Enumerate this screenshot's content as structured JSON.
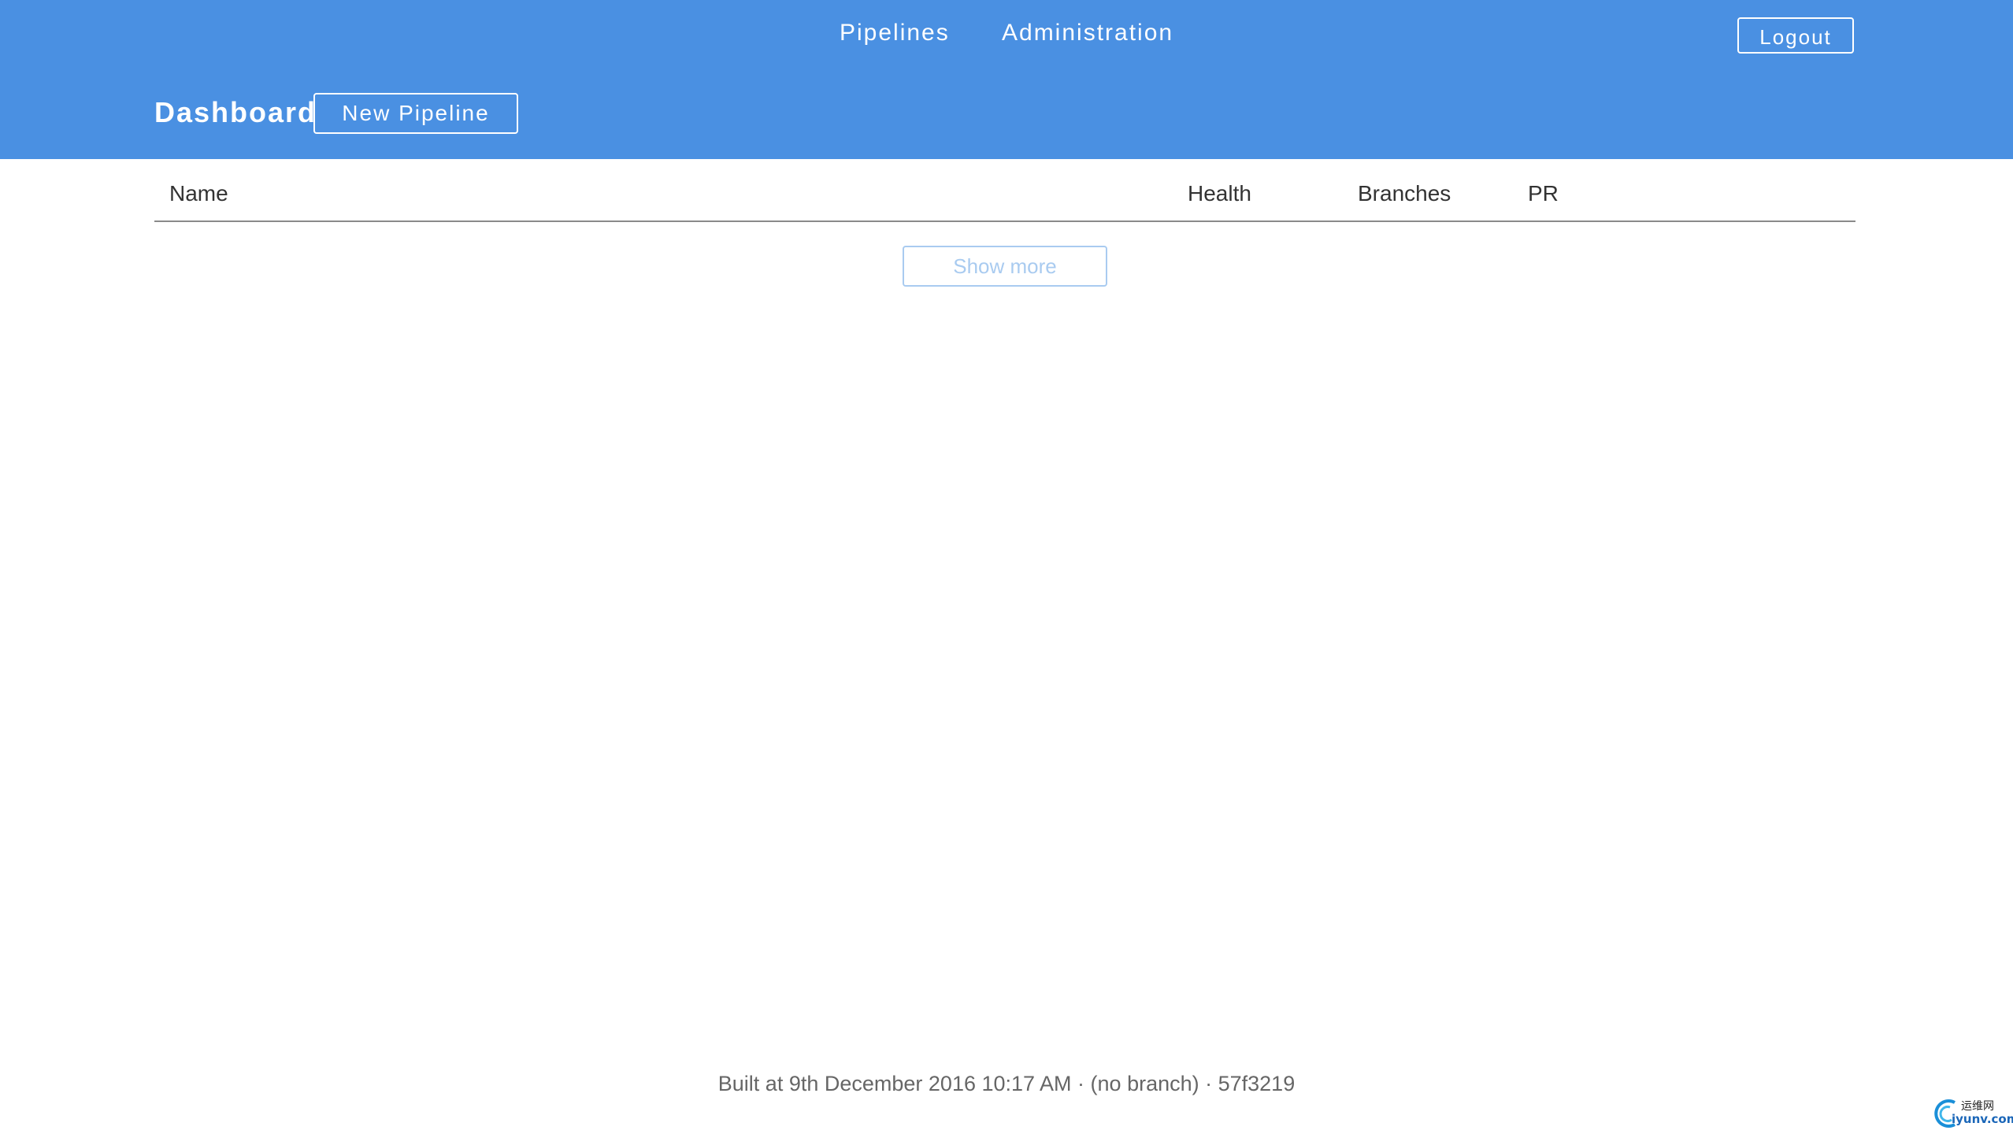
{
  "nav": {
    "pipelines_label": "Pipelines",
    "administration_label": "Administration",
    "logout_label": "Logout"
  },
  "header": {
    "title": "Dashboard",
    "new_pipeline_label": "New Pipeline"
  },
  "table": {
    "columns": [
      "Name",
      "Health",
      "Branches",
      "PR"
    ],
    "rows": [],
    "show_more_label": "Show more"
  },
  "footer": {
    "build_info": "Built at 9th December 2016 10:17 AM · (no branch) · 57f3219"
  },
  "watermark": {
    "line1": "运维网",
    "line2": "iyunv.com"
  },
  "colors": {
    "header_bg": "#4a90e2",
    "header_text": "#ffffff",
    "show_more_disabled": "#a9cbf0"
  }
}
